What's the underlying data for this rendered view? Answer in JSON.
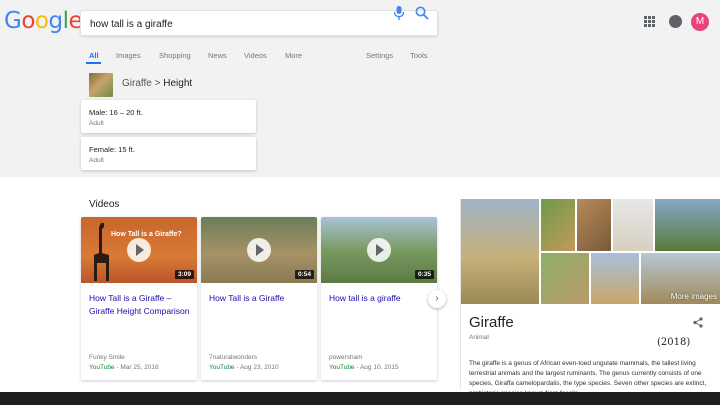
{
  "header": {
    "search_query": "how tall is a giraffe"
  },
  "avatar_letter": "M",
  "tabs": [
    {
      "label": "All",
      "active": true
    },
    {
      "label": "Images"
    },
    {
      "label": "Shopping"
    },
    {
      "label": "News"
    },
    {
      "label": "Videos"
    },
    {
      "label": "More"
    },
    {
      "label": "Settings"
    },
    {
      "label": "Tools"
    }
  ],
  "featured": {
    "breadcrumb_animal": "Giraffe",
    "breadcrumb_separator": " > ",
    "breadcrumb_attribute": "Height",
    "facts": [
      {
        "value": "Male: 16 – 20 ft.",
        "label": "Adult"
      },
      {
        "value": "Female: 15 ft.",
        "label": "Adult"
      }
    ]
  },
  "videos": {
    "heading": "Videos",
    "items": [
      {
        "title": "How Tall is a Giraffe – Giraffe Height Comparison",
        "thumb_caption": "How Tall is a Giraffe?",
        "duration": "3:09",
        "channel": "Funky Smile",
        "source": "YouTube",
        "date": " - Mar 25, 2016"
      },
      {
        "title": "How Tall is a Giraffe",
        "thumb_caption": "",
        "duration": "0:54",
        "channel": "7naturalwonders",
        "source": "YouTube",
        "date": " - Aug 23, 2010"
      },
      {
        "title": "How tall is a giraffe",
        "thumb_caption": "",
        "duration": "0:35",
        "channel": "powersham",
        "source": "YouTube",
        "date": " - Aug 10, 2015"
      }
    ]
  },
  "knowledge_panel": {
    "title": "Giraffe",
    "subtitle": "Animal",
    "more_images": "More images",
    "year_badge": "(2018)",
    "description": "The giraffe is a genus of African even-toed ungulate mammals, the tallest living terrestrial animals and the largest ruminants. The genus currently consists of one species, Giraffa camelopardalis, the type species. Seven other species are extinct, prehistoric species known from fossils."
  },
  "colors": {
    "accent": "#1a73e8",
    "link": "#1a0dab",
    "source_green": "#0d8a3a",
    "avatar": "#e8437a"
  },
  "icons": [
    "mic-icon",
    "search-icon",
    "apps-icon",
    "notifications-icon",
    "share-icon",
    "play-icon",
    "chevron-right-icon"
  ]
}
